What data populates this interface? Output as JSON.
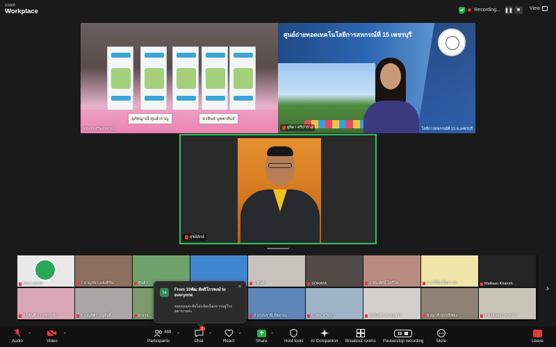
{
  "app": {
    "brand_top": "zoom",
    "brand_bottom": "Workplace"
  },
  "topbar": {
    "recording_label": "Recording...",
    "pause_icon": "pause-icon",
    "stop_icon": "stop-icon",
    "view_label": "View"
  },
  "main_tiles": {
    "top_left": {
      "namecard_1": "สุภัทญาณี ลุ่มสำราญ",
      "namecard_2": "ทาสินธ์ บุพพาสินธ์",
      "label": "กรมส่งเสริมสหกรณ์"
    },
    "top_right": {
      "title": "ศูนย์ถ่ายทอดเทคโนโลยีการสหกรณ์ที่ 15 เพชรบุรี",
      "name": "ยุพิดา ศรีบำราง",
      "footer": "โลยีการสหกรณ์ที่ 15 จ.เพชรบุรี"
    },
    "center": {
      "name": "สุชล์ลักษ์"
    }
  },
  "gallery": {
    "row1": [
      {
        "label": "014 | admin"
      },
      {
        "label": "7 กาญจนา แสงที่รัน"
      },
      {
        "label": "ศูนย์ฯ"
      },
      {
        "label": ""
      },
      {
        "label": "1 ศูนย์ฯ"
      },
      {
        "label": "SORAYA"
      },
      {
        "label": "3 สุระทัศน์ โตรีโต"
      },
      {
        "label": "6 อารีรัน ฉิ่นรา ชา"
      },
      {
        "label": "Maliwan Khamth..."
      }
    ],
    "row2": [
      {
        "label": "8 ปิยันตี กาเจชกรณี"
      },
      {
        "label": "6 เบญจิศา บุญสิงคิ์"
      },
      {
        "label": "8 นาง..."
      },
      {
        "label": ""
      },
      {
        "label": "3 นางปรานี กัลยาณ..."
      },
      {
        "label": "6 กลม สวิมปา"
      },
      {
        "label": "9 มัมฟศร นาแบงาร"
      },
      {
        "label": "8 สุมาลี ฤกกณิชยะ"
      },
      {
        "label": "4 น้ำอ้อย ยาระชาระ"
      }
    ]
  },
  "chat_toast": {
    "avatar": "1ส",
    "from": "From 10พัฒ ลัทธิโกรพงษ์ to everyone",
    "message": "ขอบคุณค่ะฟังไม่ถนัดเนื่องจากอยู่โรงพยาบาลค่ะ",
    "close_icon": "close-icon"
  },
  "toolbar": {
    "audio": "Audio",
    "video": "Video",
    "participants": "Participants",
    "participants_count": "468",
    "chat": "Chat",
    "chat_badge": "3",
    "react": "React",
    "share": "Share",
    "host_tools": "Host tools",
    "ai_companion": "AI Companion",
    "breakout_rooms": "Breakout rooms",
    "pause_stop_recording": "Pause/stop recording",
    "more": "More",
    "leave": "Leave"
  },
  "colors": {
    "active_speaker": "#31c35c",
    "danger": "#e23b3b",
    "share_green": "#22b14c"
  }
}
